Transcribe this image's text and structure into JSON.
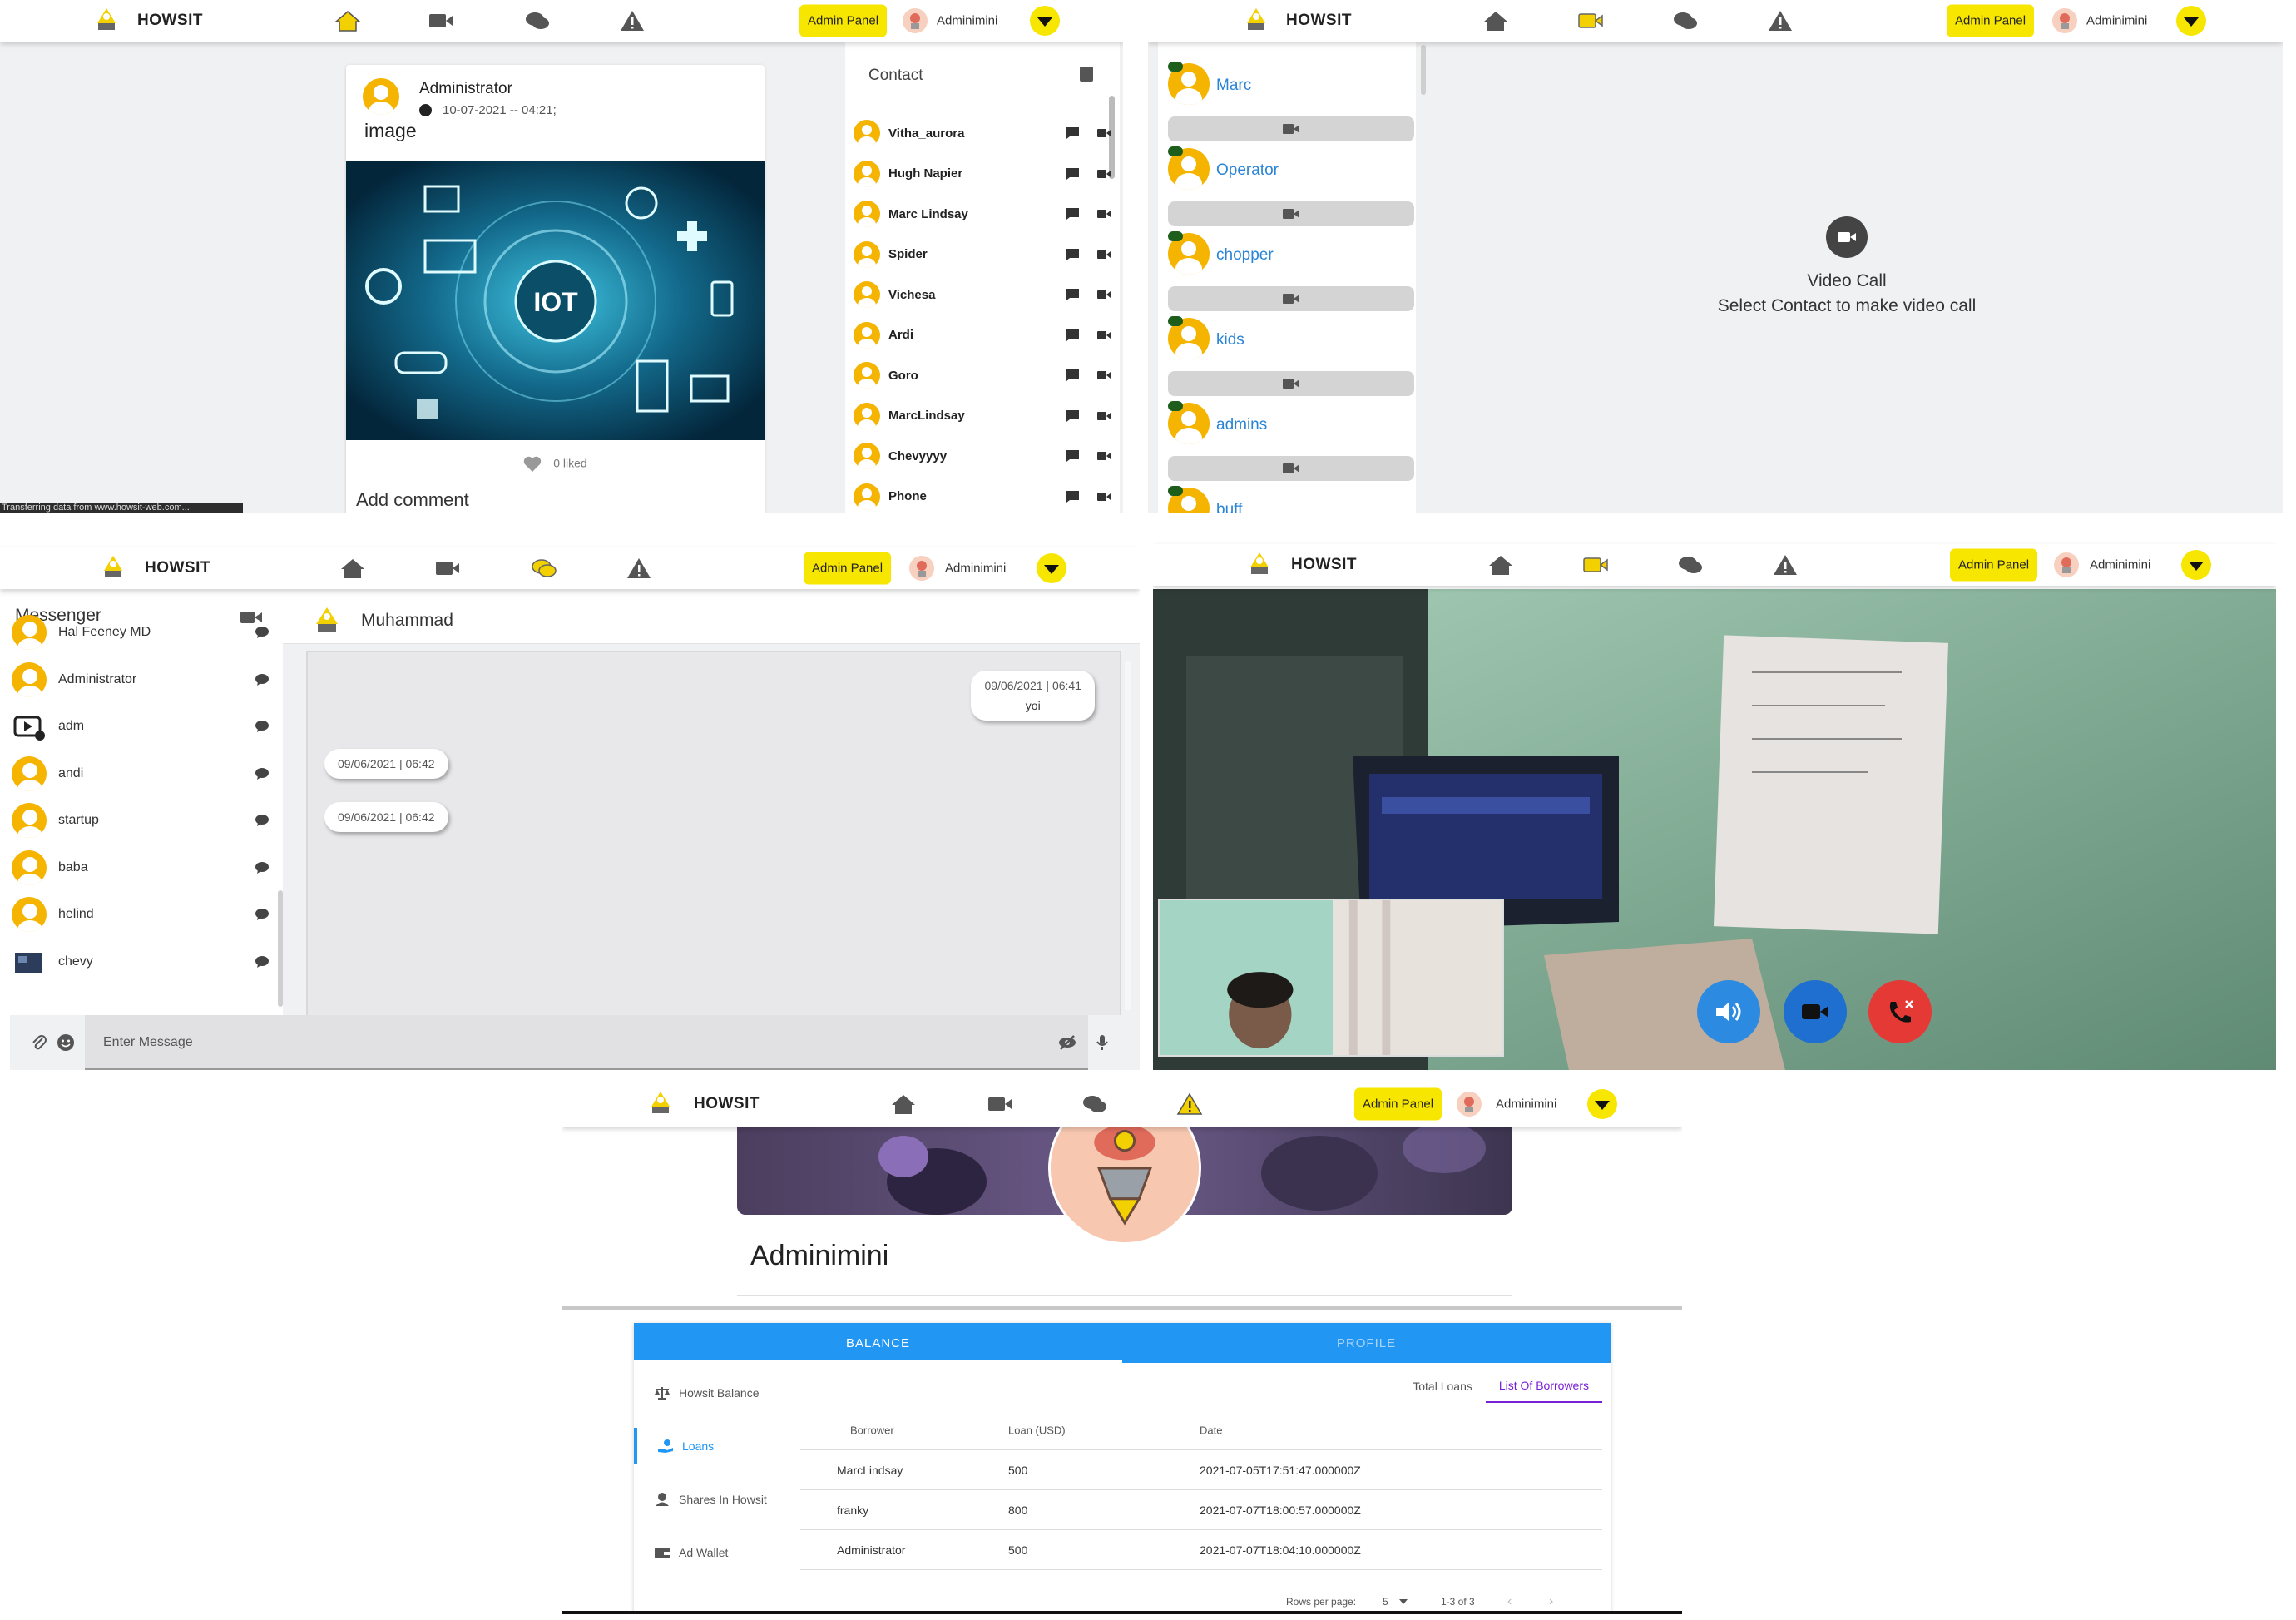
{
  "brand": "HOWSIT",
  "admin_panel_label": "Admin Panel",
  "username": "Adminimini",
  "feed": {
    "author": "Administrator",
    "date": "10-07-2021 -- 04:21;",
    "text": "image",
    "image_label": "IOT",
    "likes": "0 liked",
    "add_comment": "Add comment",
    "status_text": "Transferring data from www.howsit-web.com...",
    "contact_heading": "Contact",
    "contacts": [
      "Vitha_aurora",
      "Hugh Napier",
      "Marc Lindsay",
      "Spider",
      "Vichesa",
      "Ardi",
      "Goro",
      "MarcLindsay",
      "Chevyyyy",
      "Phone"
    ]
  },
  "video_contacts": {
    "contacts": [
      "Marc",
      "Operator",
      "chopper",
      "kids",
      "admins",
      "buff"
    ],
    "empty_title": "Video Call",
    "empty_subtitle": "Select Contact to make video call"
  },
  "messenger": {
    "heading": "Messenger",
    "contacts": [
      "Hal Feeney MD",
      "Administrator",
      "adm",
      "andi",
      "startup",
      "baba",
      "helind",
      "chevy"
    ],
    "chat_name": "Muhammad",
    "messages": [
      {
        "time": "09/06/2021 | 06:41",
        "text": "yoi",
        "side": "right"
      },
      {
        "time": "09/06/2021 | 06:42",
        "text": "",
        "side": "left"
      },
      {
        "time": "09/06/2021 | 06:42",
        "text": "",
        "side": "left"
      }
    ],
    "input_placeholder": "Enter Message"
  },
  "profile": {
    "name": "Adminimini",
    "tabs": [
      "BALANCE",
      "PROFILE"
    ],
    "side_menu": [
      "Howsit Balance",
      "Loans",
      "Shares In Howsit",
      "Ad Wallet"
    ],
    "right_tabs": [
      "Total Loans",
      "List Of Borrowers"
    ],
    "table": {
      "headers": [
        "Borrower",
        "Loan (USD)",
        "Date"
      ],
      "rows": [
        [
          "MarcLindsay",
          "500",
          "2021-07-05T17:51:47.000000Z"
        ],
        [
          "franky",
          "800",
          "2021-07-07T18:00:57.000000Z"
        ],
        [
          "Administrator",
          "500",
          "2021-07-07T18:04:10.000000Z"
        ]
      ],
      "rows_per_page_label": "Rows per page:",
      "rows_per_page": "5",
      "range": "1-3 of 3"
    }
  },
  "colors": {
    "accent_yellow": "#f7e600",
    "blue": "#2196f3",
    "link_blue": "#2a84d6",
    "avatar_orange": "#f5b400",
    "call_red": "#e53935"
  }
}
